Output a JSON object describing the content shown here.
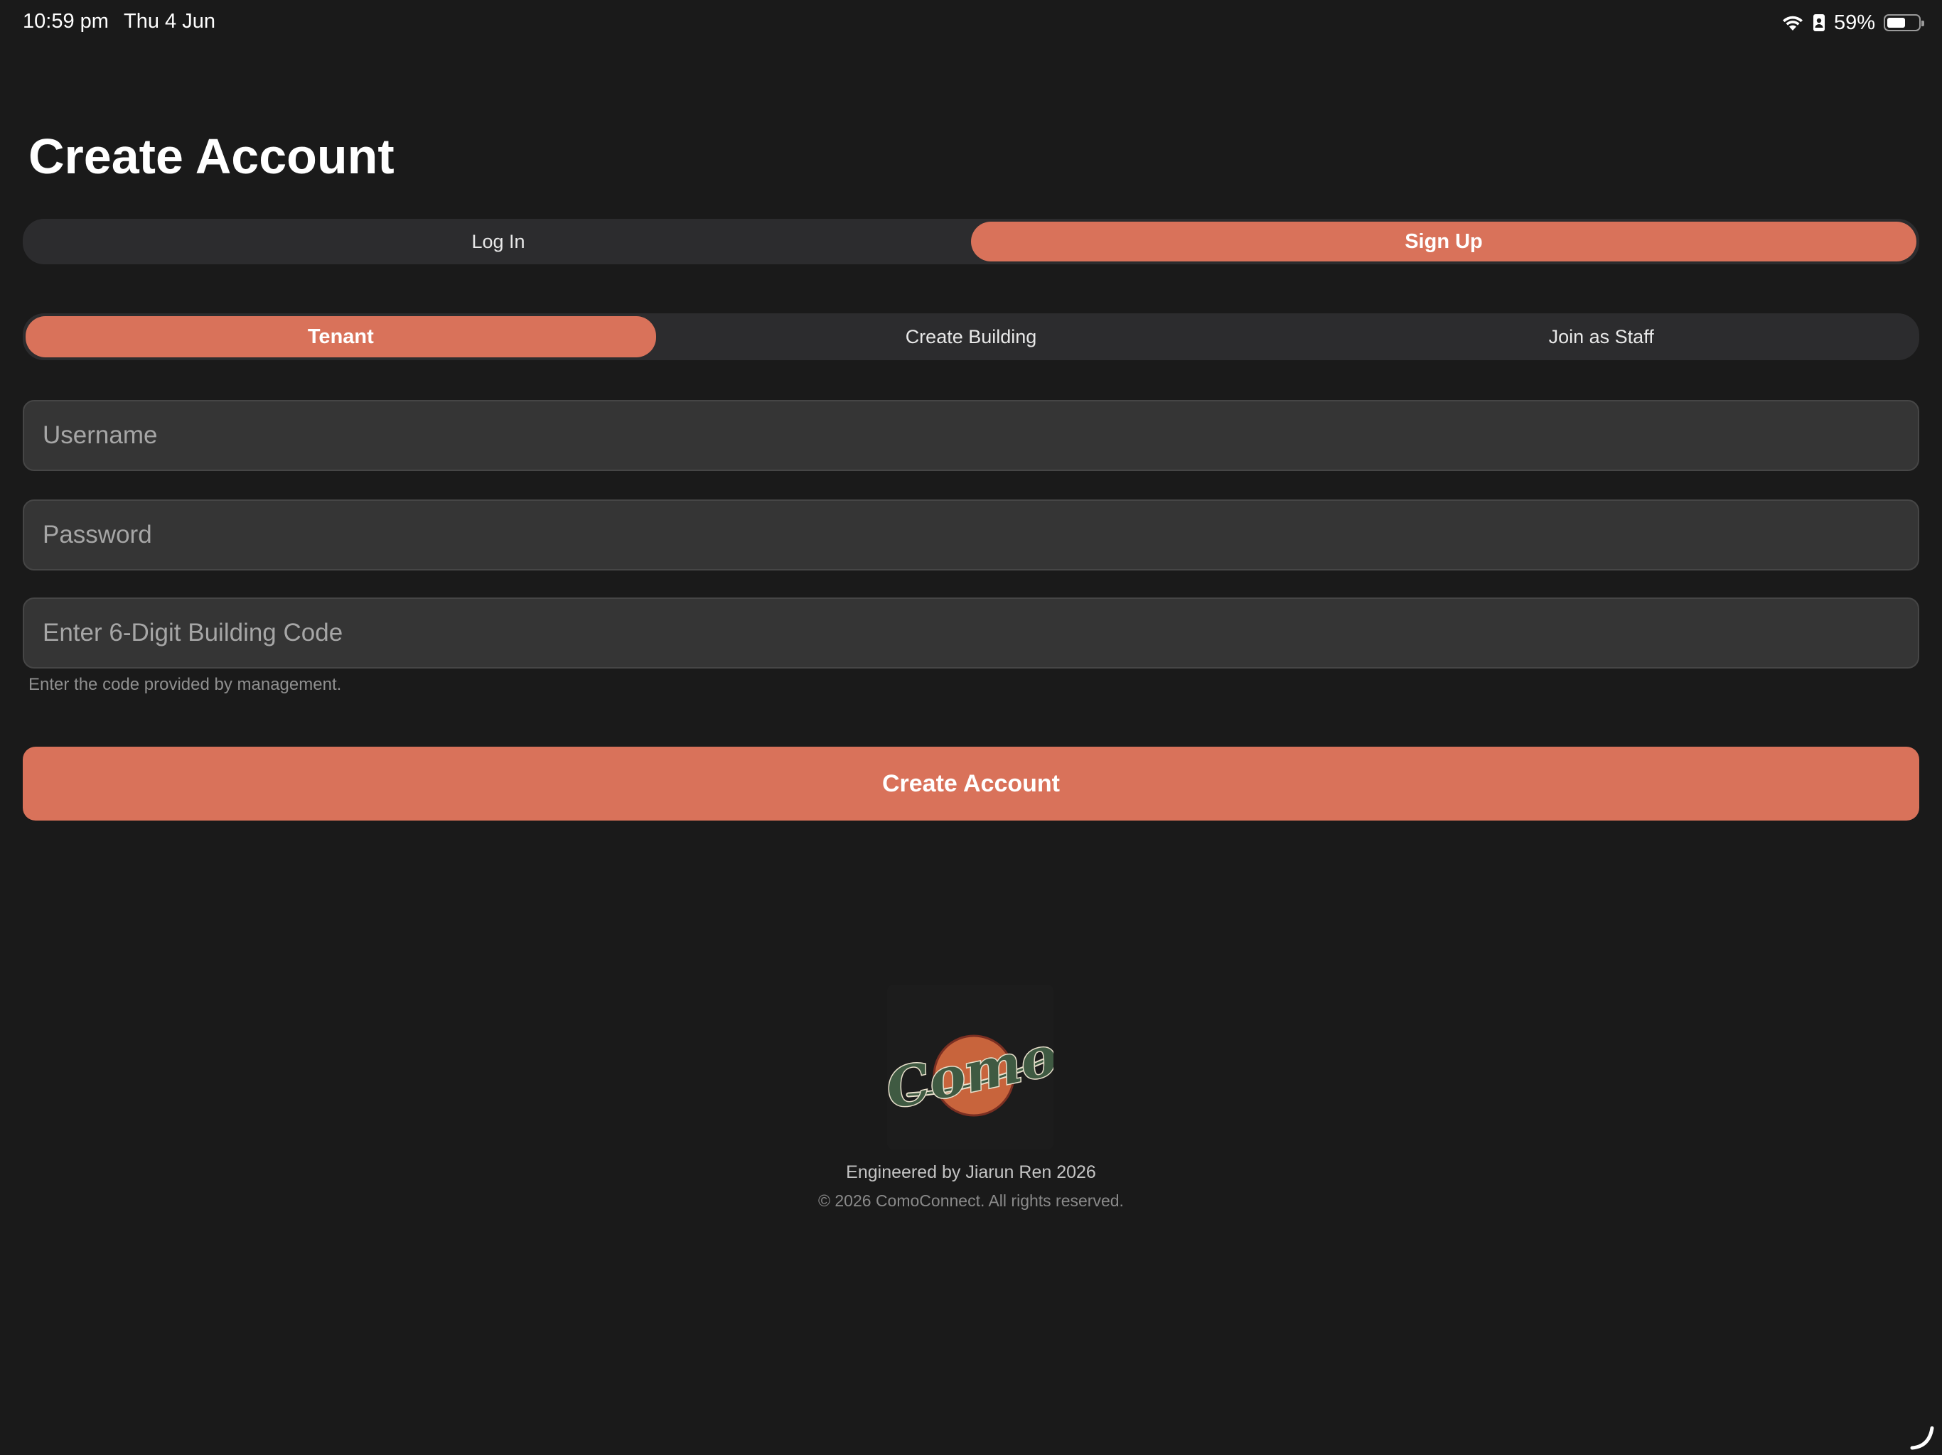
{
  "status_bar": {
    "time": "10:59 pm",
    "date": "Thu 4 Jun",
    "battery_percent": "59%",
    "battery_level": 0.59,
    "icons": [
      "wifi-icon",
      "sim-card-icon",
      "battery-icon"
    ]
  },
  "page": {
    "title": "Create Account"
  },
  "auth_toggle": {
    "options": [
      "Log In",
      "Sign Up"
    ],
    "selected": "Sign Up"
  },
  "role_toggle": {
    "options": [
      "Tenant",
      "Create Building",
      "Join as Staff"
    ],
    "selected": "Tenant"
  },
  "form": {
    "username_placeholder": "Username",
    "username_value": "",
    "password_placeholder": "Password",
    "password_value": "",
    "building_code_placeholder": "Enter 6-Digit Building Code",
    "building_code_value": "",
    "building_code_hint": "Enter the code provided by management.",
    "submit_label": "Create Account"
  },
  "footer": {
    "logo_text": "Como",
    "engineered_by": "Engineered by Jiarun Ren 2026",
    "copyright": "© 2026 ComoConnect. All rights reserved."
  },
  "colors": {
    "background": "#1a1a1a",
    "accent": "#d9725a",
    "segment_bg": "#2c2c2e",
    "field_bg": "#353535",
    "logo_green": "#3f5a42",
    "logo_orange": "#c8643c"
  }
}
